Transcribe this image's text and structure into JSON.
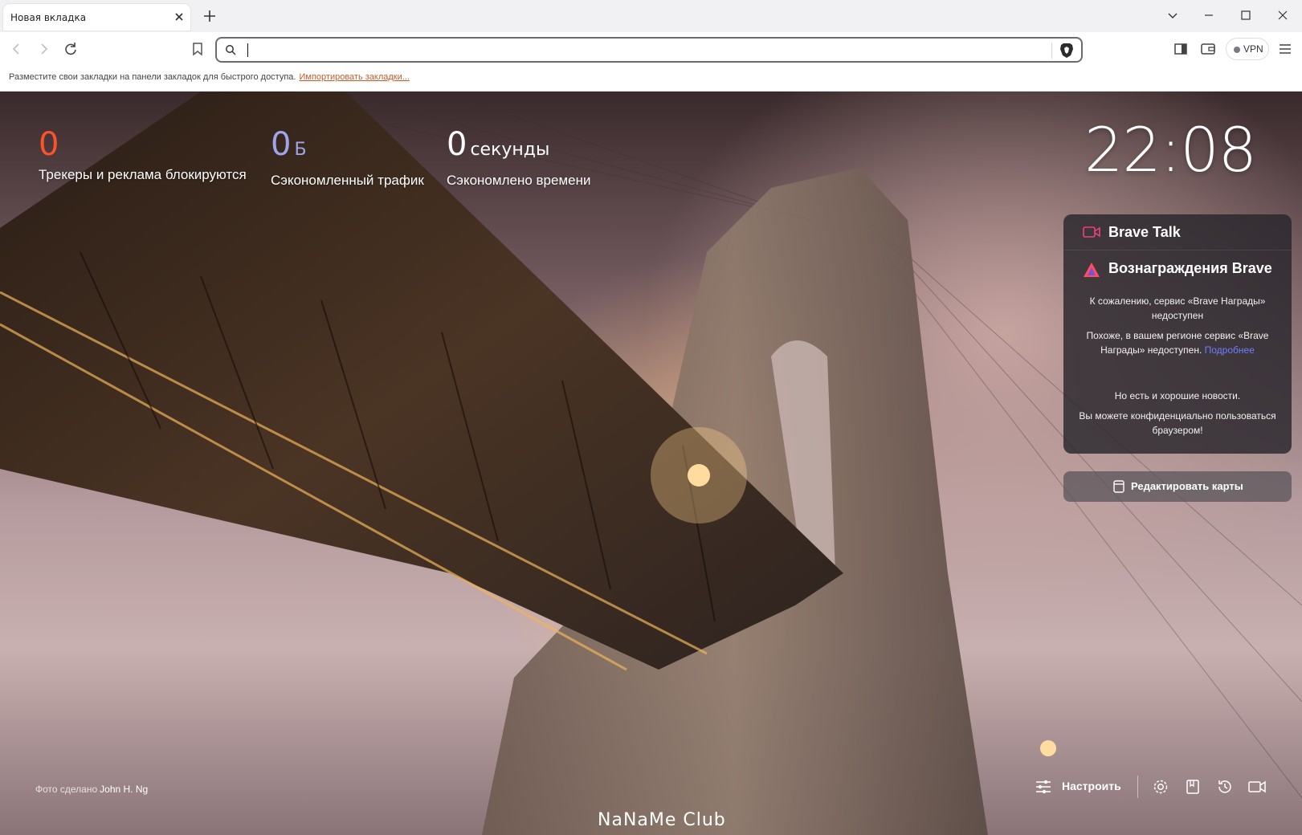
{
  "tab": {
    "title": "Новая вкладка"
  },
  "toolbar": {
    "address_value": "",
    "vpn_label": "VPN"
  },
  "bookmarks_bar": {
    "hint": "Разместите свои закладки на панели закладок для быстрого доступа.",
    "import_link": "Импортировать закладки..."
  },
  "stats": [
    {
      "value": "0",
      "unit": "",
      "label": "Трекеры и реклама блокируются",
      "color": "#fb542b"
    },
    {
      "value": "0",
      "unit": "Б",
      "label": "Сэкономленный трафик",
      "color": "#a0a5eb"
    },
    {
      "value": "0",
      "unit": "секунды",
      "label": "Сэкономлено времени",
      "color": "#ffffff"
    }
  ],
  "clock": {
    "time": "22:08"
  },
  "brave_talk": {
    "title": "Brave Talk"
  },
  "rewards": {
    "title": "Вознаграждения Brave",
    "unavailable": "К сожалению, сервис «Brave Награды» недоступен",
    "region_text": "Похоже, в вашем регионе сервис «Brave Награды» недоступен.",
    "more_link": "Подробнее",
    "good_news": "Но есть и хорошие новости.",
    "private_use": "Вы можете конфиденциально пользоваться браузером!"
  },
  "edit_cards": {
    "label": "Редактировать карты"
  },
  "photo_credit": {
    "prefix": "Фото сделано",
    "author": "John H. Ng"
  },
  "bottom_bar": {
    "customize_label": "Настроить"
  },
  "watermark": {
    "text": "NaNaMe Club"
  },
  "icons": {
    "tab_close": "close-icon",
    "new_tab": "plus-icon",
    "back": "arrow-left-icon",
    "forward": "arrow-right-icon",
    "reload": "reload-icon",
    "bookmark": "bookmark-icon",
    "search": "search-icon",
    "shield": "brave-shield-icon",
    "sidebar": "sidebar-icon",
    "wallet": "wallet-icon",
    "menu": "hamburger-menu-icon",
    "settings": "gear-icon",
    "bookmarks": "bookmarks-icon",
    "history": "history-icon",
    "talk": "video-camera-icon"
  }
}
